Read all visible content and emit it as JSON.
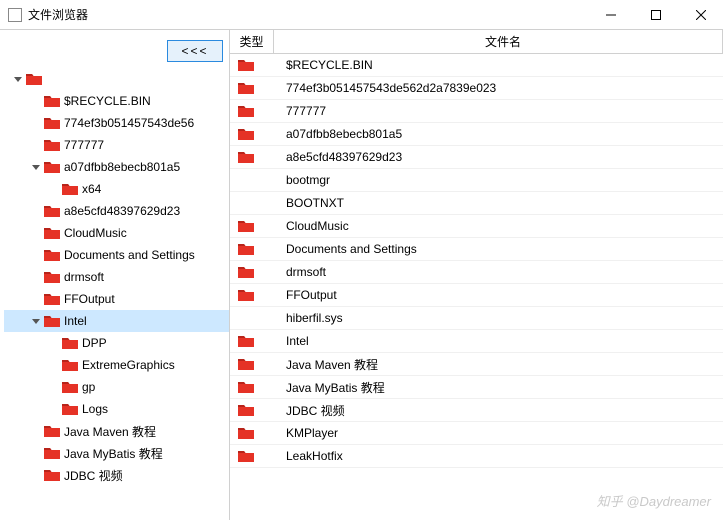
{
  "window": {
    "title": "文件浏览器",
    "collapse_button": "<<<"
  },
  "table": {
    "headers": {
      "type": "类型",
      "name": "文件名"
    },
    "rows": [
      {
        "folder": true,
        "name": "$RECYCLE.BIN"
      },
      {
        "folder": true,
        "name": "774ef3b051457543de562d2a7839e023"
      },
      {
        "folder": true,
        "name": "777777"
      },
      {
        "folder": true,
        "name": "a07dfbb8ebecb801a5"
      },
      {
        "folder": true,
        "name": "a8e5cfd48397629d23"
      },
      {
        "folder": false,
        "name": "bootmgr"
      },
      {
        "folder": false,
        "name": "BOOTNXT"
      },
      {
        "folder": true,
        "name": "CloudMusic"
      },
      {
        "folder": true,
        "name": "Documents and Settings"
      },
      {
        "folder": true,
        "name": "drmsoft"
      },
      {
        "folder": true,
        "name": "FFOutput"
      },
      {
        "folder": false,
        "name": "hiberfil.sys"
      },
      {
        "folder": true,
        "name": "Intel"
      },
      {
        "folder": true,
        "name": "Java Maven 教程"
      },
      {
        "folder": true,
        "name": "Java MyBatis 教程"
      },
      {
        "folder": true,
        "name": "JDBC 视频"
      },
      {
        "folder": true,
        "name": "KMPlayer"
      },
      {
        "folder": true,
        "name": "LeakHotfix"
      }
    ]
  },
  "tree": [
    {
      "depth": 0,
      "expander": "down",
      "label": "",
      "selected": false
    },
    {
      "depth": 1,
      "expander": "",
      "label": "$RECYCLE.BIN",
      "selected": false
    },
    {
      "depth": 1,
      "expander": "",
      "label": "774ef3b051457543de56",
      "selected": false
    },
    {
      "depth": 1,
      "expander": "",
      "label": "777777",
      "selected": false
    },
    {
      "depth": 1,
      "expander": "down",
      "label": "a07dfbb8ebecb801a5",
      "selected": false
    },
    {
      "depth": 2,
      "expander": "",
      "label": "x64",
      "selected": false
    },
    {
      "depth": 1,
      "expander": "",
      "label": "a8e5cfd48397629d23",
      "selected": false
    },
    {
      "depth": 1,
      "expander": "",
      "label": "CloudMusic",
      "selected": false
    },
    {
      "depth": 1,
      "expander": "",
      "label": "Documents and Settings",
      "selected": false
    },
    {
      "depth": 1,
      "expander": "",
      "label": "drmsoft",
      "selected": false
    },
    {
      "depth": 1,
      "expander": "",
      "label": "FFOutput",
      "selected": false
    },
    {
      "depth": 1,
      "expander": "down",
      "label": "Intel",
      "selected": true
    },
    {
      "depth": 2,
      "expander": "",
      "label": "DPP",
      "selected": false
    },
    {
      "depth": 2,
      "expander": "",
      "label": "ExtremeGraphics",
      "selected": false
    },
    {
      "depth": 2,
      "expander": "",
      "label": "gp",
      "selected": false
    },
    {
      "depth": 2,
      "expander": "",
      "label": "Logs",
      "selected": false
    },
    {
      "depth": 1,
      "expander": "",
      "label": "Java Maven 教程",
      "selected": false
    },
    {
      "depth": 1,
      "expander": "",
      "label": "Java MyBatis 教程",
      "selected": false
    },
    {
      "depth": 1,
      "expander": "",
      "label": "JDBC 视频",
      "selected": false
    }
  ],
  "watermark": "知乎 @Daydreamer"
}
